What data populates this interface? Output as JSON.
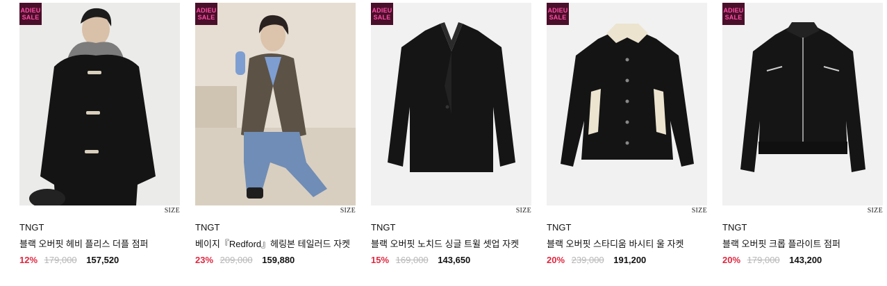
{
  "products": [
    {
      "badge_line1": "ADIEU",
      "badge_line2": "SALE",
      "size_label": "SIZE",
      "brand": "TNGT",
      "title": "블랙 오버핏 헤비 플리스 더플 점퍼",
      "discount": "12%",
      "original_price": "179,000",
      "sale_price": "157,520"
    },
    {
      "badge_line1": "ADIEU",
      "badge_line2": "SALE",
      "size_label": "SIZE",
      "brand": "TNGT",
      "title": "베이지『Redford』헤링본 테일러드 자켓",
      "discount": "23%",
      "original_price": "209,000",
      "sale_price": "159,880"
    },
    {
      "badge_line1": "ADIEU",
      "badge_line2": "SALE",
      "size_label": "SIZE",
      "brand": "TNGT",
      "title": "블랙 오버핏 노치드 싱글 트윌 셋업 자켓",
      "discount": "15%",
      "original_price": "169,000",
      "sale_price": "143,650"
    },
    {
      "badge_line1": "ADIEU",
      "badge_line2": "SALE",
      "size_label": "SIZE",
      "brand": "TNGT",
      "title": "블랙 오버핏 스타디움 바시티 울 자켓",
      "discount": "20%",
      "original_price": "239,000",
      "sale_price": "191,200"
    },
    {
      "badge_line1": "ADIEU",
      "badge_line2": "SALE",
      "size_label": "SIZE",
      "brand": "TNGT",
      "title": "블랙 오버핏 크롭 플라이트 점퍼",
      "discount": "20%",
      "original_price": "179,000",
      "sale_price": "143,200"
    }
  ],
  "colors": {
    "discount": "#e0273f",
    "badge_bg": "#4a0f2a",
    "badge_text": "#ff4da6"
  },
  "icons": [
    "product-photo-duffle-jumper",
    "product-photo-model-tailored-jacket",
    "product-photo-notched-jacket",
    "product-photo-varsity-jacket",
    "product-photo-flight-jumper"
  ]
}
